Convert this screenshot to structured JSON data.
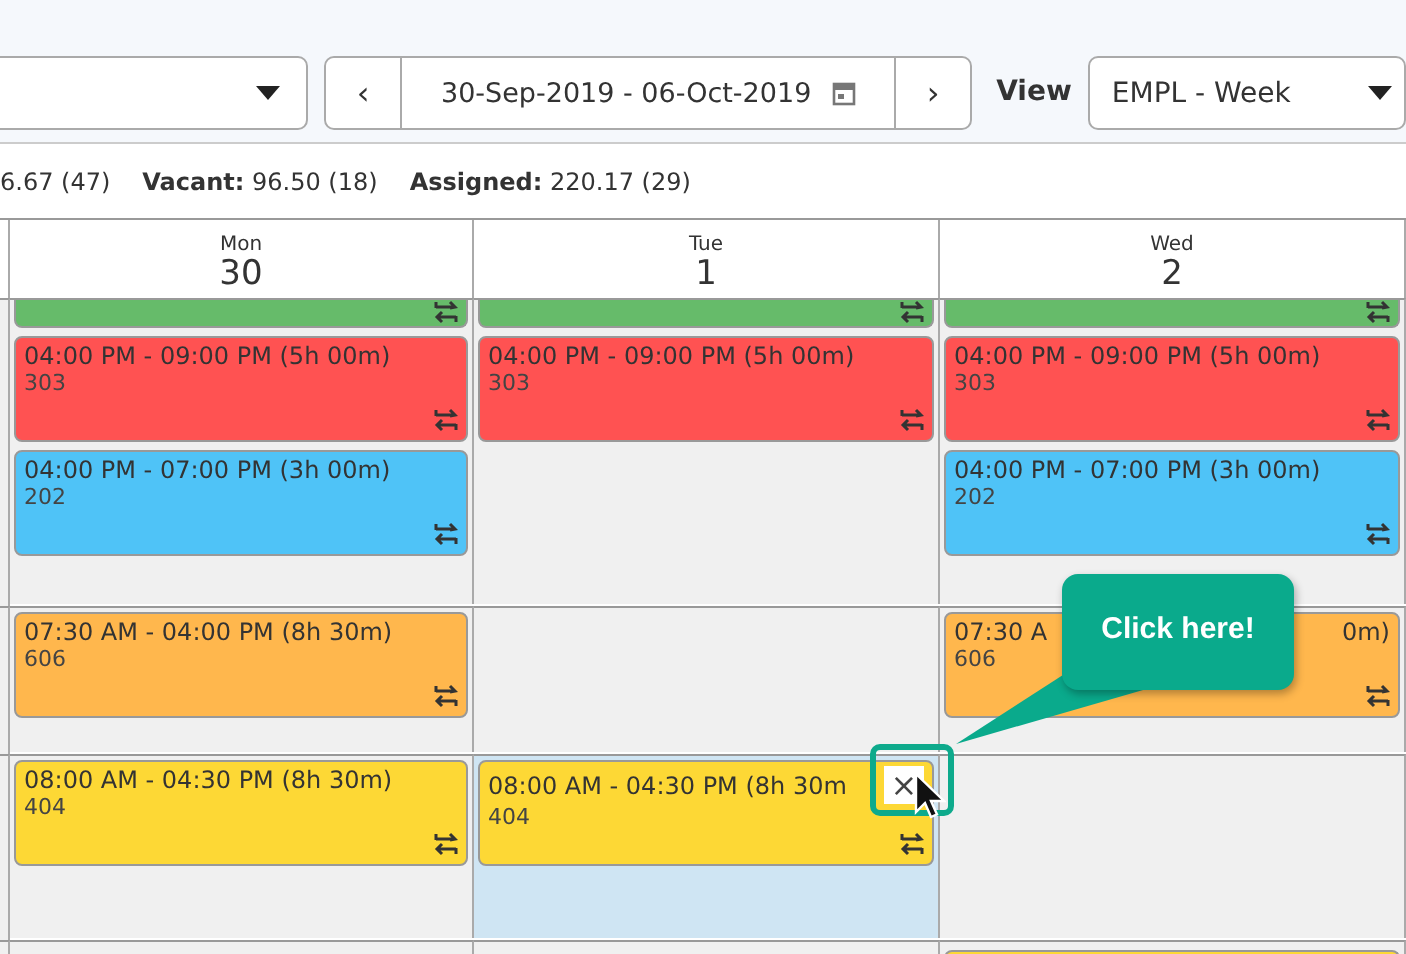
{
  "toolbar": {
    "date_range": {
      "prev": "‹",
      "label": "30-Sep-2019 - 06-Oct-2019",
      "next": "›"
    },
    "view": {
      "label": "View",
      "value": "EMPL - Week"
    }
  },
  "summary": [
    "6.67 (47)",
    "**Vacant:** 96.50 (18)",
    "**Assigned:** 220.17 (29)"
  ],
  "days": [
    {
      "weekday": "Mon",
      "date": "30"
    },
    {
      "weekday": "Tue",
      "date": "1"
    },
    {
      "weekday": "Wed",
      "date": "2"
    }
  ],
  "rows": [
    {
      "cells": [
        {
          "selected": false,
          "shifts": [
            {
              "color": "#66bb6a",
              "cut": true
            },
            {
              "color": "#ff5252",
              "time": "04:00 PM - 09:00 PM (5h 00m)",
              "code": "303"
            },
            {
              "color": "#4fc3f7",
              "time": "04:00 PM - 07:00 PM (3h 00m)",
              "code": "202"
            }
          ]
        },
        {
          "selected": false,
          "shifts": [
            {
              "color": "#66bb6a",
              "cut": true
            },
            {
              "color": "#ff5252",
              "time": "04:00 PM - 09:00 PM (5h 00m)",
              "code": "303"
            }
          ]
        },
        {
          "selected": false,
          "shifts": [
            {
              "color": "#66bb6a",
              "cut": true
            },
            {
              "color": "#ff5252",
              "time": "04:00 PM - 09:00 PM (5h 00m)",
              "code": "303"
            },
            {
              "color": "#4fc3f7",
              "time": "04:00 PM - 07:00 PM (3h 00m)",
              "code": "202"
            }
          ]
        }
      ]
    },
    {
      "cells": [
        {
          "selected": false,
          "shifts": [
            {
              "color": "#ffb74d",
              "time": "07:30 AM - 04:00 PM (8h 30m)",
              "code": "606"
            }
          ]
        },
        {
          "selected": false
        },
        {
          "selected": false,
          "shifts": [
            {
              "color": "#ffb74d",
              "time": "07:30 A",
              "time_end": "0m)",
              "code": "606"
            }
          ]
        }
      ]
    },
    {
      "cells": [
        {
          "selected": false,
          "shifts": [
            {
              "color": "#fdd835",
              "time": "08:00 AM - 04:30 PM (8h 30m)",
              "code": "404"
            }
          ]
        },
        {
          "selected": true,
          "shifts": [
            {
              "color": "#fdd835",
              "time": "08:00 AM - 04:30 PM (8h 30m",
              "code": "404",
              "close": "×"
            }
          ]
        },
        {
          "selected": false
        }
      ]
    },
    {
      "cells": [
        {
          "selected": false
        },
        {
          "selected": false
        },
        {
          "selected": false,
          "shifts": [
            {
              "color": "#fdd835",
              "cut": true
            }
          ]
        }
      ]
    }
  ],
  "callout": {
    "text": "Click here!"
  }
}
